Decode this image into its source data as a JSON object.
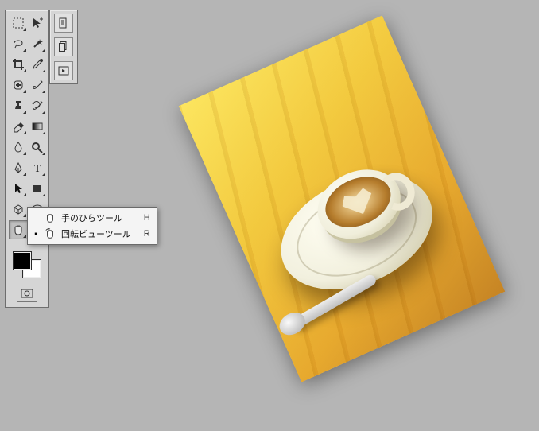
{
  "canvas": {
    "rotation_deg": -24,
    "subject": "latte-art coffee cup on wooden table"
  },
  "toolbox": {
    "tools": [
      {
        "name": "rectangular-marquee-icon",
        "has_submenu": true
      },
      {
        "name": "move-icon",
        "has_submenu": false
      },
      {
        "name": "lasso-icon",
        "has_submenu": true
      },
      {
        "name": "magic-wand-icon",
        "has_submenu": true
      },
      {
        "name": "crop-icon",
        "has_submenu": true
      },
      {
        "name": "eyedropper-icon",
        "has_submenu": true
      },
      {
        "name": "healing-brush-icon",
        "has_submenu": true
      },
      {
        "name": "brush-icon",
        "has_submenu": true
      },
      {
        "name": "clone-stamp-icon",
        "has_submenu": true
      },
      {
        "name": "history-brush-icon",
        "has_submenu": true
      },
      {
        "name": "eraser-icon",
        "has_submenu": true
      },
      {
        "name": "gradient-icon",
        "has_submenu": true
      },
      {
        "name": "blur-icon",
        "has_submenu": true
      },
      {
        "name": "dodge-icon",
        "has_submenu": true
      },
      {
        "name": "pen-icon",
        "has_submenu": true
      },
      {
        "name": "type-icon",
        "has_submenu": true
      },
      {
        "name": "path-selection-icon",
        "has_submenu": true
      },
      {
        "name": "rectangle-shape-icon",
        "has_submenu": true
      },
      {
        "name": "threeD-icon",
        "has_submenu": true
      },
      {
        "name": "notes-icon",
        "has_submenu": true
      },
      {
        "name": "hand-icon",
        "has_submenu": true,
        "selected": true
      },
      {
        "name": "zoom-icon",
        "has_submenu": false
      }
    ],
    "swatches": {
      "foreground": "#000000",
      "background": "#FFFFFF"
    },
    "screen_mode_name": "screen-mode-icon"
  },
  "minipanel": {
    "buttons": [
      {
        "name": "document-icon"
      },
      {
        "name": "documents-stack-icon"
      },
      {
        "name": "play-icon"
      }
    ]
  },
  "flyout": {
    "items": [
      {
        "current": true,
        "icon": "hand-icon",
        "label": "手のひらツール",
        "shortcut": "H"
      },
      {
        "current": false,
        "icon": "rotate-view-icon",
        "label": "回転ビューツール",
        "shortcut": "R"
      }
    ]
  }
}
